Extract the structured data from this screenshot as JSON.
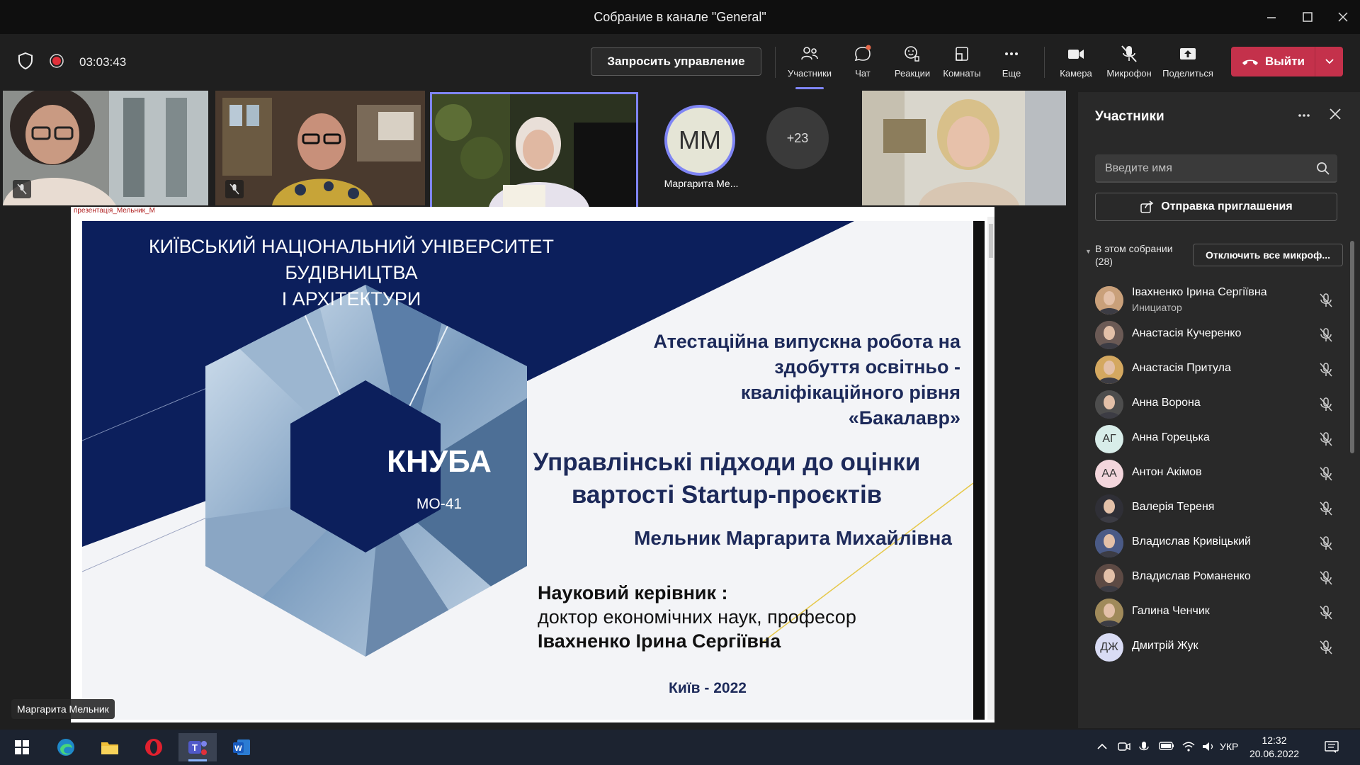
{
  "window": {
    "title": "Собрание в канале \"General\""
  },
  "toolbar": {
    "timer": "03:03:43",
    "request_control": "Запросить управление",
    "controls": [
      {
        "label": "Участники",
        "icon": "people-icon"
      },
      {
        "label": "Чат",
        "icon": "chat-icon"
      },
      {
        "label": "Реакции",
        "icon": "reactions-icon"
      },
      {
        "label": "Комнаты",
        "icon": "rooms-icon"
      },
      {
        "label": "Еще",
        "icon": "more-icon"
      },
      {
        "label": "Камера",
        "icon": "camera-icon"
      },
      {
        "label": "Микрофон",
        "icon": "mic-off-icon"
      },
      {
        "label": "Поделиться",
        "icon": "share-icon"
      }
    ],
    "leave": "Выйти"
  },
  "video": {
    "avatar_initials": "ММ",
    "avatar_name": "Маргарита Ме...",
    "overflow": "+23"
  },
  "share": {
    "tab": "презентація_Мельник_М",
    "name_tag": "Маргарита Мельник"
  },
  "slide": {
    "university_line1": "КИЇВСЬКИЙ НАЦІОНАЛЬНИЙ УНІВЕРСИТЕТ БУДІВНИЦТВА",
    "university_line2": "І АРХІТЕКТУРИ",
    "attestation": [
      "Атестаційна випускна робота на",
      "здобуття освітньо -",
      "кваліфікаційного рівня",
      "«Бакалавр»"
    ],
    "topic": [
      "Управлінські підходи до оцінки",
      "вартості Startup-проєктів"
    ],
    "author": "Мельник Маргарита Михайлівна",
    "supervisor_heading": "Науковий керівник :",
    "supervisor_title": "доктор економічних наук, професор",
    "supervisor_name": "Івахненко Ірина Сергіївна",
    "city_year": "Київ - 2022",
    "abbr": "КНУБА",
    "group": "МО-41",
    "colors": {
      "navy": "#0c1f5c",
      "title_text": "#1d2a5a",
      "accent_line": "#e6c84a"
    }
  },
  "panel": {
    "title": "Участники",
    "search_placeholder": "Введите имя",
    "invite": "Отправка приглашения",
    "section_label": "В этом собрании",
    "section_count": "(28)",
    "mute_all": "Отключить все микроф...",
    "participants": [
      {
        "name": "Івахненко Ірина Сергіївна",
        "role": "Инициатор",
        "avatar": "photo",
        "color": "#c9a07a"
      },
      {
        "name": "Анастасія Кучеренко",
        "role": "",
        "avatar": "photo",
        "color": "#6b5a55"
      },
      {
        "name": "Анастасія Притула",
        "role": "",
        "avatar": "photo",
        "color": "#d4a860"
      },
      {
        "name": "Анна Ворона",
        "role": "",
        "avatar": "photo",
        "color": "#4d4d4d"
      },
      {
        "name": "Анна Горецька",
        "role": "",
        "avatar": "АГ",
        "color": "#d8ede9"
      },
      {
        "name": "Антон Акімов",
        "role": "",
        "avatar": "АА",
        "color": "#f3d6dc"
      },
      {
        "name": "Валерія Тереня",
        "role": "",
        "avatar": "photo",
        "color": "#2f2f36"
      },
      {
        "name": "Владислав Кривіцький",
        "role": "",
        "avatar": "photo",
        "color": "#4a5a86"
      },
      {
        "name": "Владислав Романенко",
        "role": "",
        "avatar": "photo",
        "color": "#5d4a44"
      },
      {
        "name": "Галина Ченчик",
        "role": "",
        "avatar": "photo",
        "color": "#a08a5a"
      },
      {
        "name": "Дмитрій Жук",
        "role": "",
        "avatar": "ДЖ",
        "color": "#d9dcf4"
      }
    ]
  },
  "taskbar": {
    "apps": [
      {
        "icon": "windows-start-icon"
      },
      {
        "icon": "edge-icon"
      },
      {
        "icon": "file-explorer-icon"
      },
      {
        "icon": "opera-icon"
      },
      {
        "icon": "teams-icon"
      },
      {
        "icon": "word-icon"
      }
    ],
    "language": "УКР",
    "time": "12:32",
    "date": "20.06.2022"
  }
}
